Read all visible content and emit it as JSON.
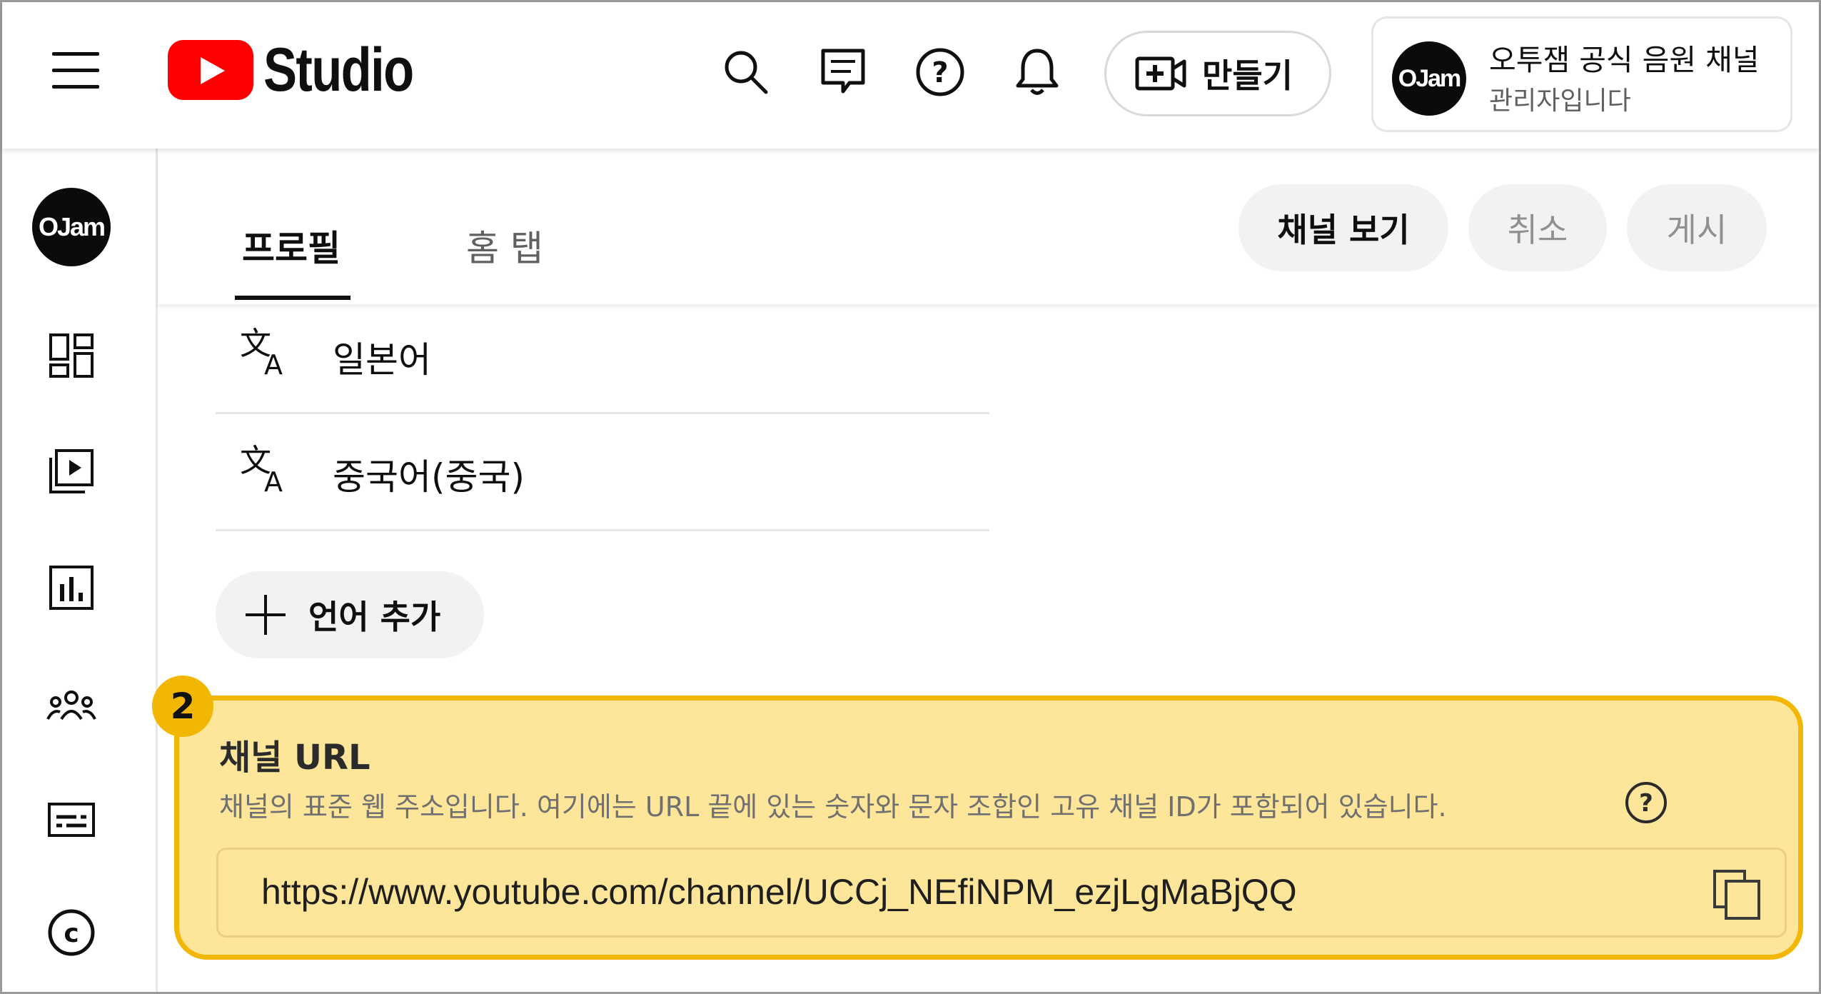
{
  "header": {
    "logo_text": "Studio",
    "icons": [
      "menu-icon",
      "search-icon",
      "feedback-icon",
      "help-icon",
      "notification-icon",
      "create-video-icon"
    ],
    "create_label": "만들기",
    "account": {
      "avatar_text": "OJam",
      "name": "오투잼 공식 음원 채널",
      "role": "관리자입니다"
    }
  },
  "sidebar": {
    "avatar_text": "OJam",
    "items": [
      {
        "icon": "dashboard-icon"
      },
      {
        "icon": "content-icon"
      },
      {
        "icon": "analytics-icon"
      },
      {
        "icon": "community-icon"
      },
      {
        "icon": "subtitles-icon"
      },
      {
        "icon": "copyright-icon"
      }
    ]
  },
  "toolbar": {
    "tabs": [
      {
        "label": "프로필",
        "active": true
      },
      {
        "label": "홈 탭",
        "active": false
      }
    ],
    "view_channel_label": "채널 보기",
    "cancel_label": "취소",
    "publish_label": "게시"
  },
  "languages": {
    "items": [
      {
        "label": "일본어",
        "icon": "translate-icon"
      },
      {
        "label": "중국어(중국)",
        "icon": "translate-icon"
      }
    ],
    "add_label": "언어 추가"
  },
  "channel_url": {
    "badge": "2",
    "title": "채널 URL",
    "description": "채널의 표준 웹 주소입니다. 여기에는 URL 끝에 있는 숫자와 문자 조합인 고유 채널 ID가 포함되어 있습니다.",
    "value": "https://www.youtube.com/channel/UCCj_NEfiNPM_ezjLgMaBjQQ",
    "highlight_color": "#fde59a",
    "border_color": "#f2b705"
  }
}
